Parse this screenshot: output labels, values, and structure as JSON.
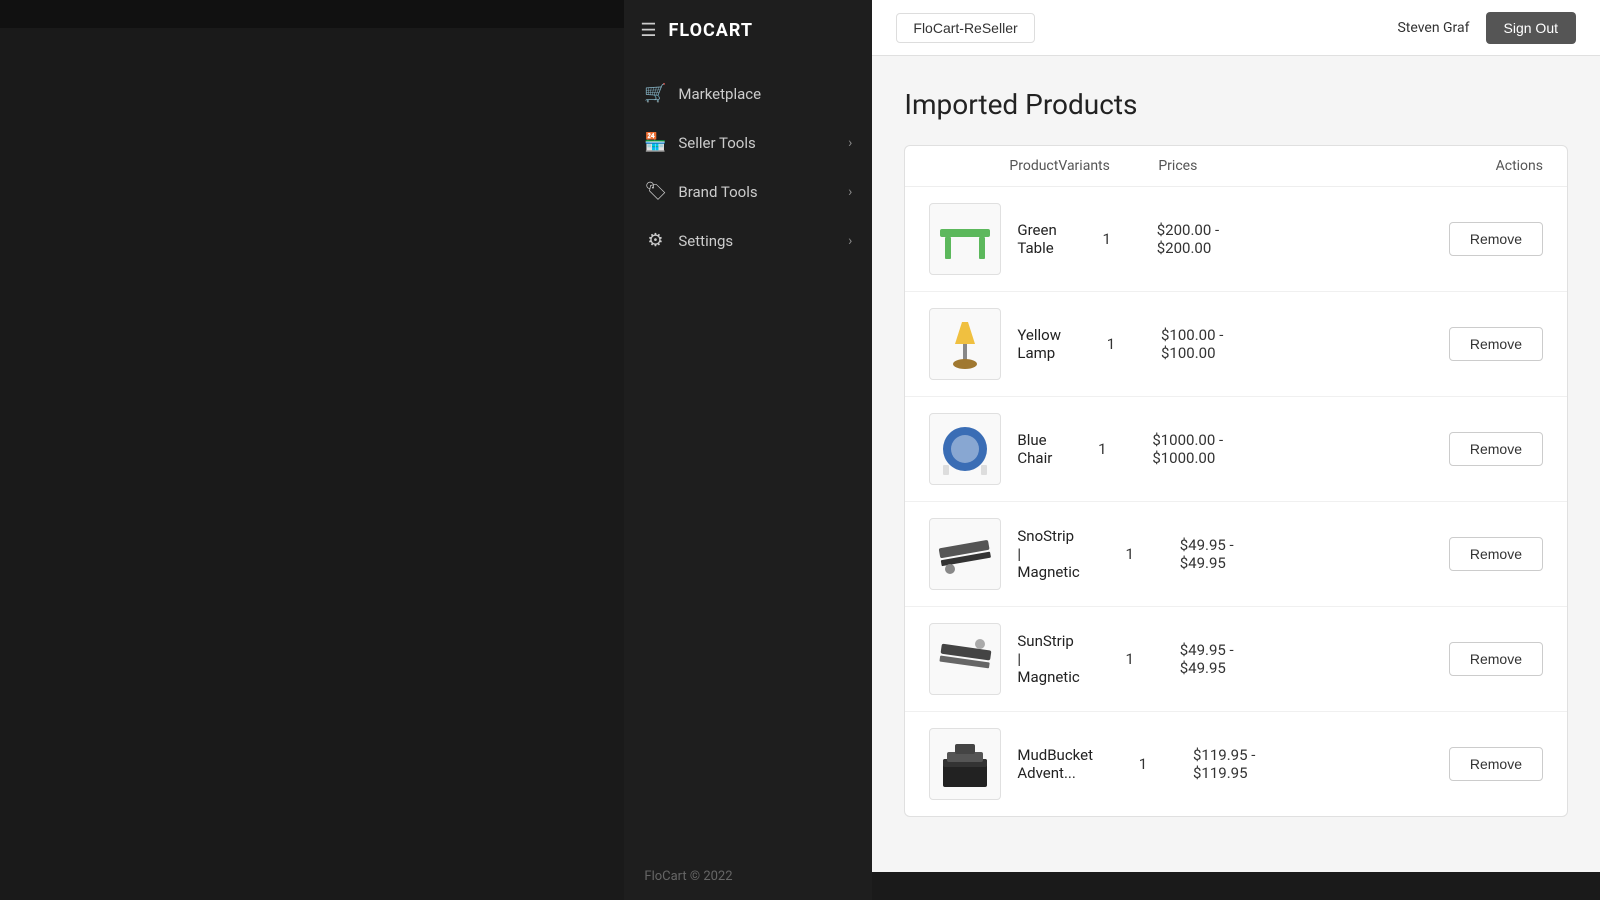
{
  "app": {
    "top_bar_bg": "#111",
    "logo": "FLOCART",
    "footer": "FloCart © 2022"
  },
  "sidebar": {
    "items": [
      {
        "id": "marketplace",
        "label": "Marketplace",
        "icon": "🛒",
        "has_chevron": false
      },
      {
        "id": "seller-tools",
        "label": "Seller Tools",
        "icon": "🏪",
        "has_chevron": true
      },
      {
        "id": "brand-tools",
        "label": "Brand Tools",
        "icon": "🏷",
        "has_chevron": true
      },
      {
        "id": "settings",
        "label": "Settings",
        "icon": "⚙",
        "has_chevron": true
      }
    ]
  },
  "header": {
    "store_tab": "FloCart-ReSeller",
    "user_name": "Steven Graf",
    "sign_out_label": "Sign Out"
  },
  "main": {
    "page_title": "Imported Products",
    "table": {
      "columns": {
        "product": "Product",
        "variants": "Variants",
        "prices": "Prices",
        "actions": "Actions"
      },
      "rows": [
        {
          "id": "green-table",
          "name": "Green Table",
          "variants": "1",
          "price_range": "$200.00 -\n$200.00",
          "action": "Remove",
          "image_color": "#5cb85c",
          "image_type": "table"
        },
        {
          "id": "yellow-lamp",
          "name": "Yellow Lamp",
          "variants": "1",
          "price_range": "$100.00 -\n$100.00",
          "action": "Remove",
          "image_color": "#f0c040",
          "image_type": "lamp"
        },
        {
          "id": "blue-chair",
          "name": "Blue Chair",
          "variants": "1",
          "price_range": "$1000.00 -\n$1000.00",
          "action": "Remove",
          "image_color": "#3a6db5",
          "image_type": "chair"
        },
        {
          "id": "snostrip",
          "name": "SnoStrip | Magnetic",
          "variants": "1",
          "price_range": "$49.95 -\n$49.95",
          "action": "Remove",
          "image_color": "#555",
          "image_type": "strip"
        },
        {
          "id": "sunstrip",
          "name": "SunStrip | Magnetic",
          "variants": "1",
          "price_range": "$49.95 -\n$49.95",
          "action": "Remove",
          "image_color": "#444",
          "image_type": "strip2"
        },
        {
          "id": "mudbucket",
          "name": "MudBucket Advent...",
          "variants": "1",
          "price_range": "$119.95 -\n$119.95",
          "action": "Remove",
          "image_color": "#222",
          "image_type": "bucket"
        }
      ]
    }
  }
}
